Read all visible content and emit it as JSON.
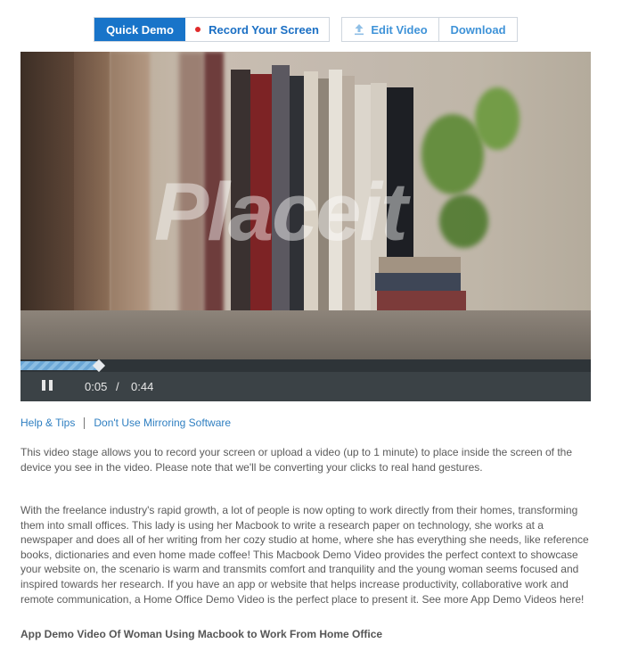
{
  "tabs": {
    "quick_demo": "Quick Demo",
    "record_screen": "Record Your Screen",
    "edit_video": "Edit Video",
    "download": "Download"
  },
  "video": {
    "watermark": "Placeit",
    "progress_fraction": 0.135,
    "current_time": "0:05",
    "separator": "/",
    "total_time": "0:44"
  },
  "links": {
    "help": "Help & Tips",
    "mirroring": "Don't Use Mirroring Software"
  },
  "text": {
    "intro": "This video stage allows you to record your screen or upload a video (up to 1 minute) to place inside the screen of the device you see in the video. Please note that we'll be converting your clicks to real hand gestures.",
    "description": "With the freelance industry's rapid growth, a lot of people is now opting to work directly from their homes, transforming them into small offices. This lady is using her Macbook to write a research paper on technology, she works at a newspaper and does all of her writing from her cozy studio at home, where she has everything she needs, like reference books, dictionaries and even home made coffee! This Macbook Demo Video provides the perfect context to showcase your website on, the scenario is warm and transmits comfort and tranquility and the young woman seems focused and inspired towards her research. If you have an app or website that helps increase productivity, collaborative work and remote communication, a Home Office Demo Video is the perfect place to present it. See more App Demo Videos here!",
    "footer_title": "App Demo Video Of Woman Using Macbook to Work From Home Office"
  },
  "icons": {
    "record": "record-dot-icon",
    "upload": "upload-icon",
    "pause": "pause-icon"
  },
  "colors": {
    "accent": "#1874c9",
    "link": "#2f7fc1",
    "record_dot": "#e02a2a",
    "player_bar": "#3b4246"
  }
}
